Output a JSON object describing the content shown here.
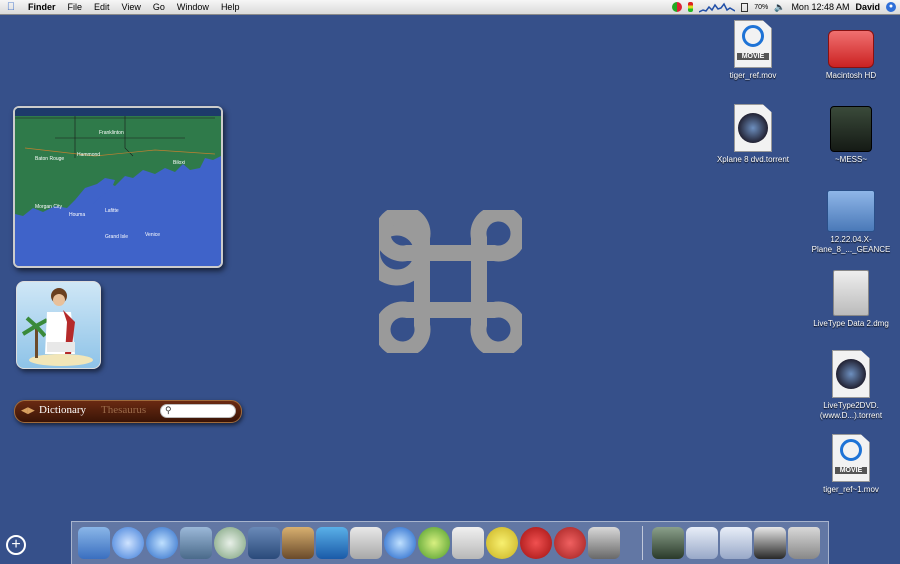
{
  "menubar": {
    "app_name": "Finder",
    "menus": [
      "File",
      "Edit",
      "View",
      "Go",
      "Window",
      "Help"
    ],
    "battery": "70%",
    "clock": "Mon 12:48 AM",
    "user": "David"
  },
  "desktop_icons": [
    {
      "label": "tiger_ref.mov",
      "badge": "MOVIE",
      "kind": "movie"
    },
    {
      "label": "Macintosh HD",
      "kind": "hard-drive"
    },
    {
      "label": "Xplane 8 dvd.torrent",
      "kind": "torrent"
    },
    {
      "label": "~MESS~",
      "kind": "disk"
    },
    {
      "label": "12.22.04.X-Plane_8_..._GEANCE",
      "kind": "folder"
    },
    {
      "label": "LiveType Data 2.dmg",
      "kind": "dmg"
    },
    {
      "label": "LiveType2DVD.(www.D...).torrent",
      "kind": "torrent"
    },
    {
      "label": "tiger_ref~1.mov",
      "badge": "MOVIE",
      "kind": "movie"
    }
  ],
  "weather_map": {
    "places": [
      "Franklinton",
      "Baton Rouge",
      "Hammond",
      "Biloxi",
      "Morgan City",
      "Houma",
      "Lafitte",
      "Grand Isle",
      "Venice"
    ],
    "colors": {
      "land": "#2f7a4a",
      "water": "#3f63c9"
    }
  },
  "dictionary": {
    "tab_active": "Dictionary",
    "tab_inactive": "Thesaurus"
  },
  "dock_items": [
    "finder-icon",
    "safari-icon",
    "ichat-icon",
    "preview-icon",
    "itunes-icon",
    "keynote-icon",
    "iphoto-icon",
    "dreamweaver-icon",
    "pen-icon",
    "quicktime-icon",
    "lime-icon",
    "ical-icon",
    "lemon-icon",
    "apple-icon",
    "tomato-icon",
    "camera-icon",
    "terminal-icon",
    "monitor-icon",
    "screen-icon",
    "photo-icon",
    "trash-icon"
  ],
  "colors": {
    "desktop": "#36508a",
    "command_symbol": "#9a9a9a"
  }
}
